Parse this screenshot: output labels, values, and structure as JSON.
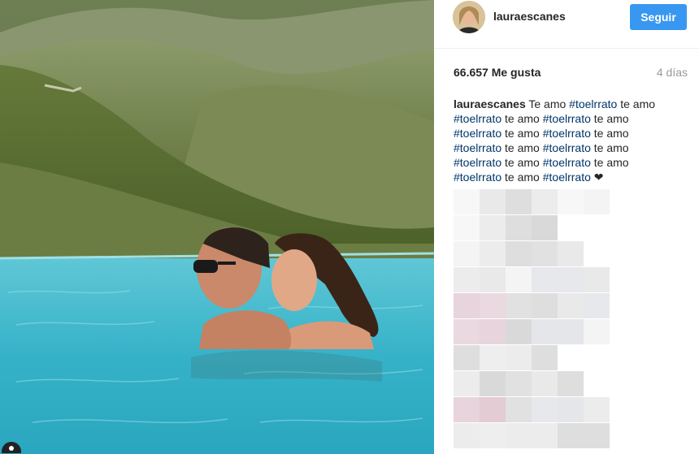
{
  "post": {
    "username": "lauraescanes",
    "follow_label": "Seguir",
    "likes": "66.657 Me gusta",
    "time_ago": "4 días",
    "caption": {
      "username": "lauraescanes",
      "lines": [
        [
          {
            "t": "text",
            "v": " Te amo "
          },
          {
            "t": "tag",
            "v": "#toelrrato"
          },
          {
            "t": "text",
            "v": " te amo"
          }
        ],
        [
          {
            "t": "tag",
            "v": "#toelrrato"
          },
          {
            "t": "text",
            "v": " te amo "
          },
          {
            "t": "tag",
            "v": "#toelrrato"
          },
          {
            "t": "text",
            "v": " te amo"
          }
        ],
        [
          {
            "t": "tag",
            "v": "#toelrrato"
          },
          {
            "t": "text",
            "v": " te amo "
          },
          {
            "t": "tag",
            "v": "#toelrrato"
          },
          {
            "t": "text",
            "v": " te amo"
          }
        ],
        [
          {
            "t": "tag",
            "v": "#toelrrato"
          },
          {
            "t": "text",
            "v": " te amo "
          },
          {
            "t": "tag",
            "v": "#toelrrato"
          },
          {
            "t": "text",
            "v": " te amo"
          }
        ],
        [
          {
            "t": "tag",
            "v": "#toelrrato"
          },
          {
            "t": "text",
            "v": " te amo "
          },
          {
            "t": "tag",
            "v": "#toelrrato"
          },
          {
            "t": "text",
            "v": " te amo"
          }
        ],
        [
          {
            "t": "tag",
            "v": "#toelrrato"
          },
          {
            "t": "text",
            "v": " te amo "
          },
          {
            "t": "tag",
            "v": "#toelrrato"
          },
          {
            "t": "text",
            "v": " ❤"
          }
        ]
      ]
    }
  },
  "colors": {
    "follow_button": "#3897f0",
    "hashtag": "#003569",
    "text": "#262626",
    "muted": "#999999"
  },
  "icons": {
    "photo_corner": "user-tag-icon"
  }
}
